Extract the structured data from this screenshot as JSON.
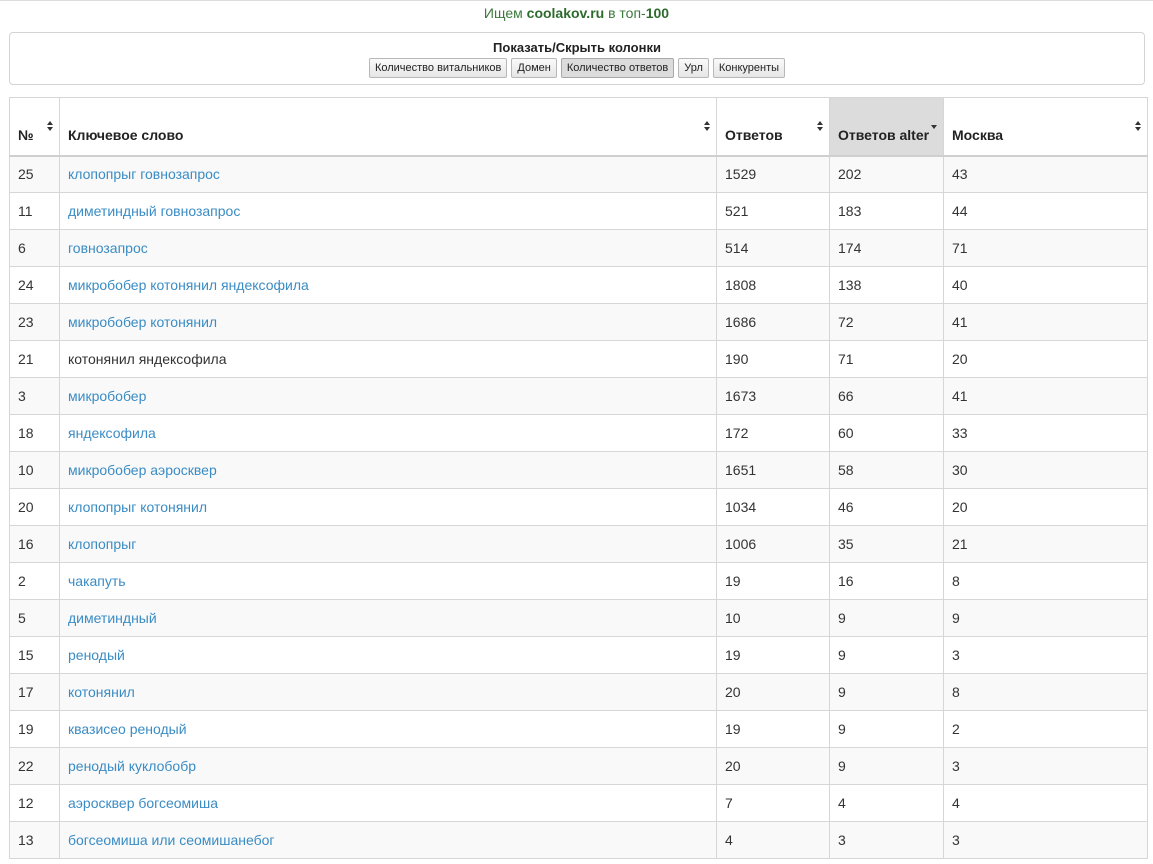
{
  "search": {
    "prefix": "Ищем",
    "domain": "coolakov.ru",
    "middle": "в топ-",
    "top": "100"
  },
  "columns_panel": {
    "title": "Показать/Скрыть колонки",
    "buttons": [
      {
        "label": "Количество витальников",
        "active": false
      },
      {
        "label": "Домен",
        "active": false
      },
      {
        "label": "Количество ответов",
        "active": true
      },
      {
        "label": "Урл",
        "active": false
      },
      {
        "label": "Конкуренты",
        "active": false
      }
    ]
  },
  "table": {
    "headers": [
      {
        "label": "№"
      },
      {
        "label": "Ключевое слово"
      },
      {
        "label": "Ответов"
      },
      {
        "label": "Ответов alter",
        "sorted": true
      },
      {
        "label": "Москва"
      }
    ],
    "rows": [
      {
        "num": "25",
        "keyword": "клопопрыг говнозапрос",
        "link": true,
        "answers": "1529",
        "alter": "202",
        "moscow": "43"
      },
      {
        "num": "11",
        "keyword": "диметиндный говнозапрос",
        "link": true,
        "answers": "521",
        "alter": "183",
        "moscow": "44"
      },
      {
        "num": "6",
        "keyword": "говнозапрос",
        "link": true,
        "answers": "514",
        "alter": "174",
        "moscow": "71"
      },
      {
        "num": "24",
        "keyword": "микробобер котонянил яндексофила",
        "link": true,
        "answers": "1808",
        "alter": "138",
        "moscow": "40"
      },
      {
        "num": "23",
        "keyword": "микробобер котонянил",
        "link": true,
        "answers": "1686",
        "alter": "72",
        "moscow": "41"
      },
      {
        "num": "21",
        "keyword": "котонянил яндексофила",
        "link": false,
        "answers": "190",
        "alter": "71",
        "moscow": "20"
      },
      {
        "num": "3",
        "keyword": "микробобер",
        "link": true,
        "answers": "1673",
        "alter": "66",
        "moscow": "41"
      },
      {
        "num": "18",
        "keyword": "яндексофила",
        "link": true,
        "answers": "172",
        "alter": "60",
        "moscow": "33"
      },
      {
        "num": "10",
        "keyword": "микробобер аэросквер",
        "link": true,
        "answers": "1651",
        "alter": "58",
        "moscow": "30"
      },
      {
        "num": "20",
        "keyword": "клопопрыг котонянил",
        "link": true,
        "answers": "1034",
        "alter": "46",
        "moscow": "20"
      },
      {
        "num": "16",
        "keyword": "клопопрыг",
        "link": true,
        "answers": "1006",
        "alter": "35",
        "moscow": "21"
      },
      {
        "num": "2",
        "keyword": "чакапуть",
        "link": true,
        "answers": "19",
        "alter": "16",
        "moscow": "8"
      },
      {
        "num": "5",
        "keyword": "диметиндный",
        "link": true,
        "answers": "10",
        "alter": "9",
        "moscow": "9"
      },
      {
        "num": "15",
        "keyword": "ренодый",
        "link": true,
        "answers": "19",
        "alter": "9",
        "moscow": "3"
      },
      {
        "num": "17",
        "keyword": "котонянил",
        "link": true,
        "answers": "20",
        "alter": "9",
        "moscow": "8"
      },
      {
        "num": "19",
        "keyword": "квазисео ренодый",
        "link": true,
        "answers": "19",
        "alter": "9",
        "moscow": "2"
      },
      {
        "num": "22",
        "keyword": "ренодый куклобобр",
        "link": true,
        "answers": "20",
        "alter": "9",
        "moscow": "3"
      },
      {
        "num": "12",
        "keyword": "аэросквер богсеомиша",
        "link": true,
        "answers": "7",
        "alter": "4",
        "moscow": "4"
      },
      {
        "num": "13",
        "keyword": "богсеомиша или сеомишанебог",
        "link": true,
        "answers": "4",
        "alter": "3",
        "moscow": "3"
      }
    ]
  },
  "colors": {
    "link": "#3a8cc4",
    "search_text": "#3c7a3c",
    "sorted_header_bg": "#dcdcdc",
    "striped_row_bg": "#f9f9f9"
  },
  "icons": {
    "sort_both": "sort-both-icon",
    "sort_desc": "sort-desc-icon"
  }
}
